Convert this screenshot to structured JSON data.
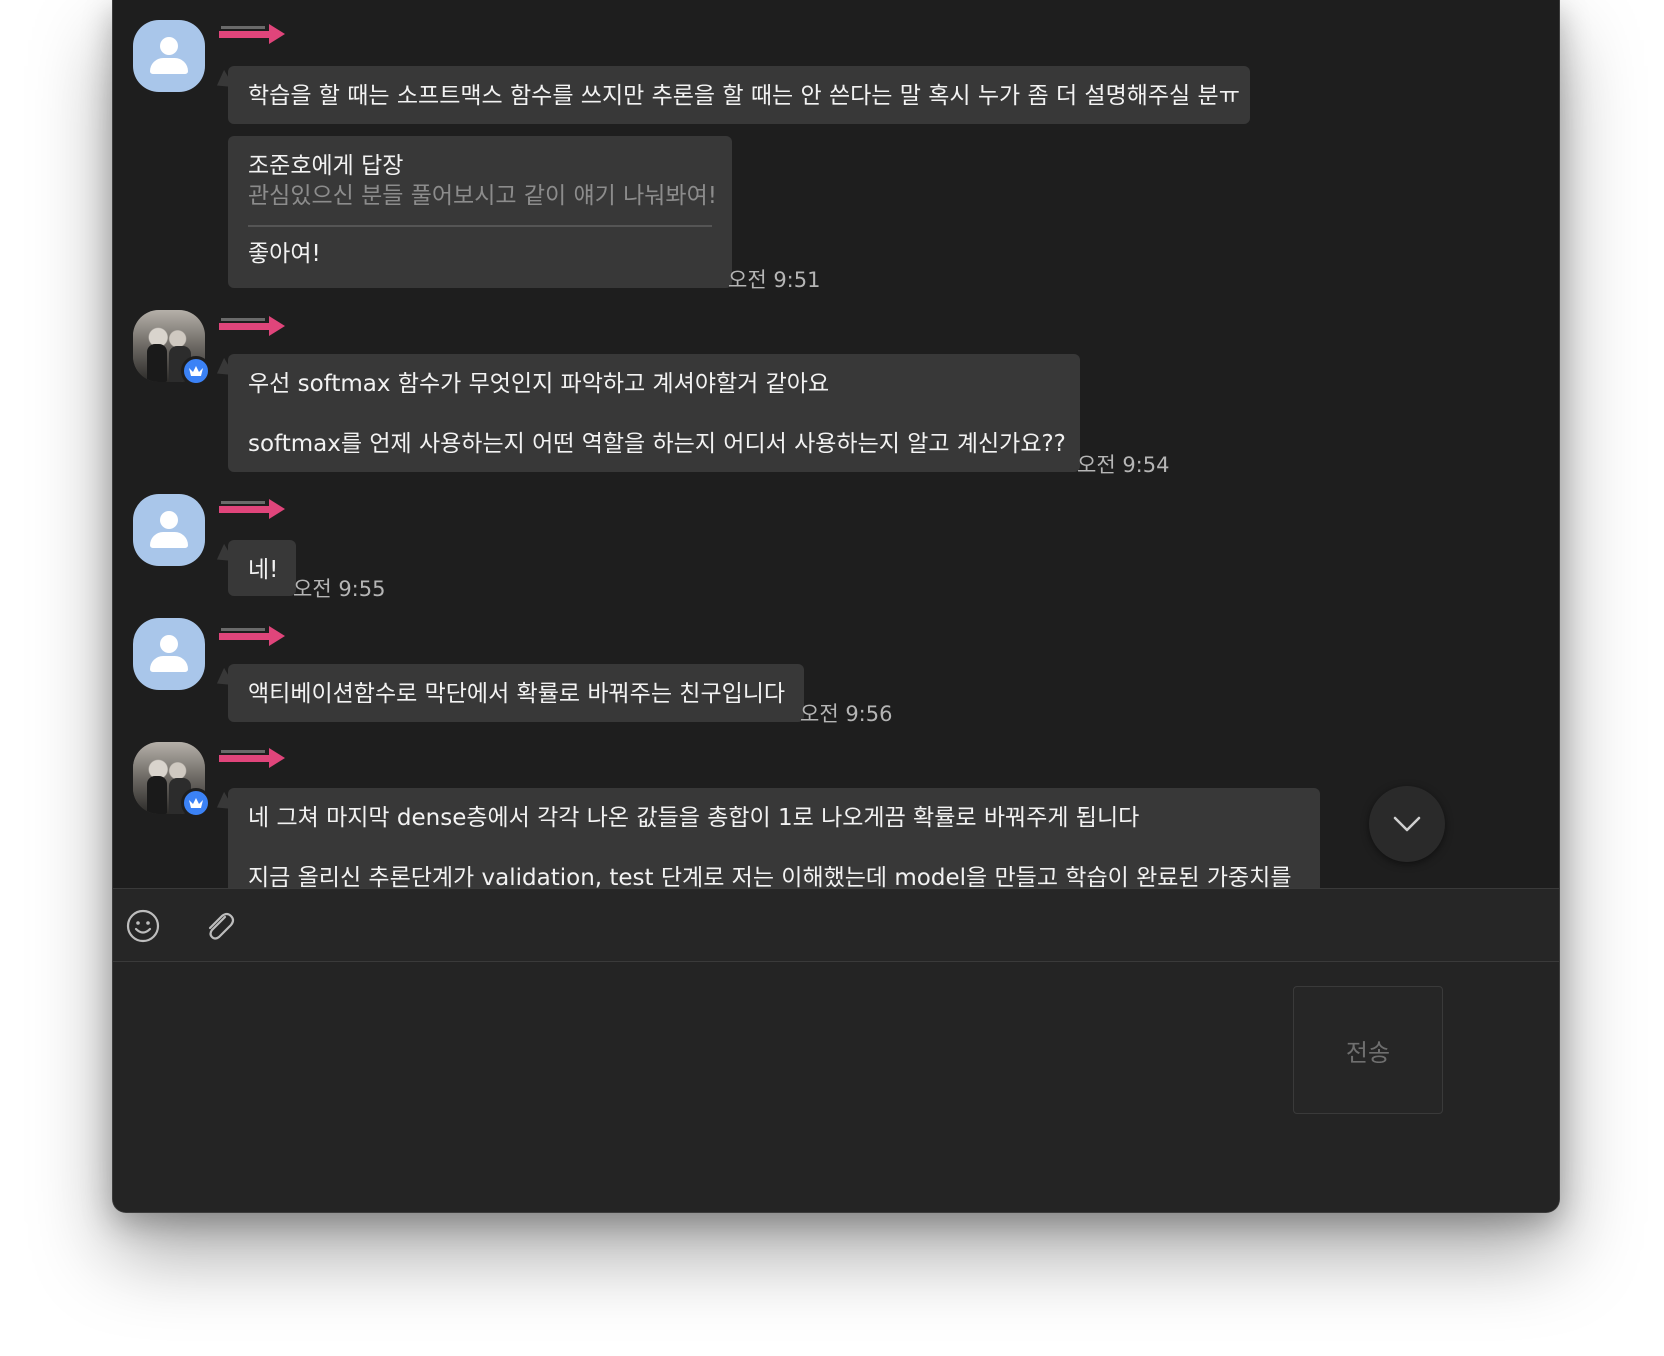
{
  "colors": {
    "window_bg": "#1e1e1e",
    "bubble_bg": "#383838",
    "bubble_text": "#f2f2f2",
    "quote_text": "#8c8c8c",
    "time_text": "#b5b5b5",
    "avatar_default": "#a9c6ea",
    "badge_blue": "#3b82f6",
    "redaction_arrow": "#e0457b"
  },
  "messages": [
    {
      "text": "학습을 할 때는 소프트맥스 함수를 쓰지만 추론을 할 때는 안 쓴다는 말 혹시 누가 좀 더 설명해주실 분ㅠ"
    },
    {
      "reply_head": "조준호에게 답장",
      "reply_quote": "관심있으신 분들 풀어보시고 같이 얘기 나눠봐여!",
      "text": "좋아여!",
      "time": "오전 9:51"
    },
    {
      "line1": "우선 softmax 함수가 무엇인지 파악하고 계셔야할거 같아요",
      "line2": "softmax를 언제 사용하는지 어떤 역할을 하는지 어디서 사용하는지 알고 계신가요??",
      "time": "오전 9:54"
    },
    {
      "text": "네!",
      "time": "오전 9:55"
    },
    {
      "text": "액티베이션함수로 막단에서 확률로 바꿔주는 친구입니다",
      "time": "오전 9:56"
    },
    {
      "line1": "네 그쳐 마지막 dense층에서 각각 나온 값들을 총합이 1로 나오게끔 확률로 바꿔주게 됩니다",
      "line2": "지금 올리신 추론단계가 validation, test 단계로 저는 이해했는데 model을 만들고 학습이 완료된 가중치를"
    }
  ],
  "toolbar": {
    "emoji_icon": "smiley-icon",
    "attach_icon": "paperclip-icon"
  },
  "input": {
    "send_label": "전송"
  }
}
